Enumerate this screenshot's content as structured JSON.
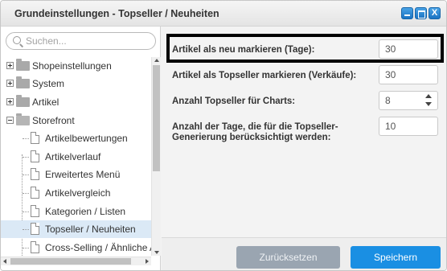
{
  "window": {
    "title": "Grundeinstellungen - Topseller / Neuheiten",
    "controls": {
      "minimize": "minimize-icon",
      "maximize": "maximize-icon",
      "close": "X"
    }
  },
  "search": {
    "placeholder": "Suchen...",
    "value": ""
  },
  "tree": {
    "items": [
      {
        "label": "Shopeinstellungen",
        "type": "folder",
        "expanded": false
      },
      {
        "label": "System",
        "type": "folder",
        "expanded": false
      },
      {
        "label": "Artikel",
        "type": "folder",
        "expanded": false
      },
      {
        "label": "Storefront",
        "type": "folder",
        "expanded": true
      },
      {
        "label": "Artikelbewertungen",
        "type": "leaf"
      },
      {
        "label": "Artikelverlauf",
        "type": "leaf"
      },
      {
        "label": "Erweitertes Menü",
        "type": "leaf"
      },
      {
        "label": "Artikelvergleich",
        "type": "leaf"
      },
      {
        "label": "Kategorien / Listen",
        "type": "leaf"
      },
      {
        "label": "Topseller / Neuheiten",
        "type": "leaf",
        "selected": true
      },
      {
        "label": "Cross-Selling / Ähnliche Ar",
        "type": "leaf"
      }
    ]
  },
  "form": {
    "fields": [
      {
        "label": "Artikel als neu markieren (Tage):",
        "value": "30"
      },
      {
        "label": "Artikel als Topseller markieren (Verkäufe):",
        "value": "30"
      },
      {
        "label": "Anzahl Topseller für Charts:",
        "value": "8"
      },
      {
        "label_line1": "Anzahl der Tage, die für die Topseller-",
        "label_line2": "Generierung berücksichtigt werden:",
        "value": "10"
      }
    ]
  },
  "footer": {
    "reset_label": "Zurücksetzen",
    "save_label": "Speichern"
  },
  "colors": {
    "accent": "#1a8fe3",
    "selection": "#dbe9f6",
    "reset_button": "#9aa5b1"
  }
}
